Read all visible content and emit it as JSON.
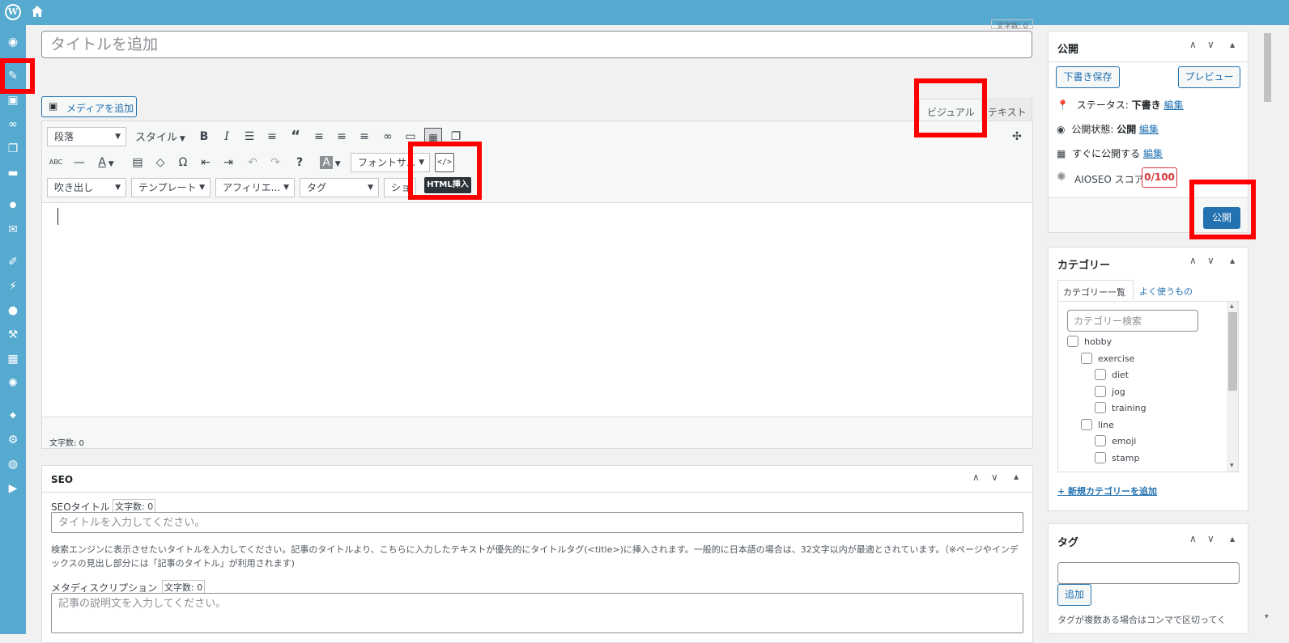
{
  "topbar": {
    "wp_icon": "wordpress-icon",
    "home_icon": "home-icon"
  },
  "sidebar": {
    "icons": [
      "dashboard-icon",
      "posts-pin-icon",
      "media-icon",
      "links-icon",
      "pages-icon",
      "comments-icon",
      "circle-icon",
      "mail-icon",
      "appearance-brush-icon",
      "plugins-icon",
      "users-icon",
      "tools-wrench-icon",
      "settings-grid-icon",
      "gear-circle-icon",
      "color-icon",
      "gear-icon",
      "world-icon",
      "play-icon"
    ]
  },
  "editor": {
    "char_count_top": "文字数: 0",
    "title_placeholder": "タイトルを追加",
    "add_media": "メディアを追加",
    "tab_visual": "ビジュアル",
    "tab_text": "テキスト",
    "toolbar": {
      "paragraph": "段落",
      "style": "スタイル",
      "font_size": "フォントサ...",
      "callout": "吹き出し",
      "template": "テンプレート",
      "affiliate": "アフィリエ...",
      "tag": "タグ",
      "shortcode": "ショ"
    },
    "tooltip": "HTML挿入",
    "word_count": "文字数: 0"
  },
  "seo": {
    "title": "SEO",
    "seo_title_label": "SEOタイトル",
    "seo_title_count": "文字数: 0",
    "seo_title_placeholder": "タイトルを入力してください。",
    "help": "検索エンジンに表示させたいタイトルを入力してください。記事のタイトルより、こちらに入力したテキストが優先的にタイトルタグ(<title>)に挿入されます。一般的に日本語の場合は、32文字以内が最適とされています。（※ページやインデックスの見出し部分には「記事のタイトル」が利用されます)",
    "meta_label": "メタディスクリプション",
    "meta_count": "文字数: 0",
    "meta_placeholder": "記事の説明文を入力してください。"
  },
  "publish": {
    "title": "公開",
    "save_draft": "下書き保存",
    "preview": "プレビュー",
    "status_label": "ステータス:",
    "status_value": "下書き",
    "visibility_label": "公開状態:",
    "visibility_value": "公開",
    "schedule": "すぐに公開する",
    "edit": "編集",
    "aioseo_label": "AIOSEO スコア",
    "aioseo_score": "0/100",
    "publish_button": "公開"
  },
  "category": {
    "title": "カテゴリー",
    "tab_all": "カテゴリー一覧",
    "tab_popular": "よく使うもの",
    "search_placeholder": "カテゴリー検索",
    "items": [
      {
        "label": "hobby",
        "level": 0
      },
      {
        "label": "exercise",
        "level": 1
      },
      {
        "label": "diet",
        "level": 2
      },
      {
        "label": "jog",
        "level": 2
      },
      {
        "label": "training",
        "level": 2
      },
      {
        "label": "line",
        "level": 1
      },
      {
        "label": "emoji",
        "level": 2
      },
      {
        "label": "stamp",
        "level": 2
      }
    ],
    "add_new": "+ 新規カテゴリーを追加"
  },
  "tags": {
    "title": "タグ",
    "add_button": "追加",
    "hint": "タグが複数ある場合はコンマで区切ってく"
  },
  "colors": {
    "admin_bar": "#56a9cf",
    "highlight": "#ff0000",
    "primary": "#2271b1"
  }
}
